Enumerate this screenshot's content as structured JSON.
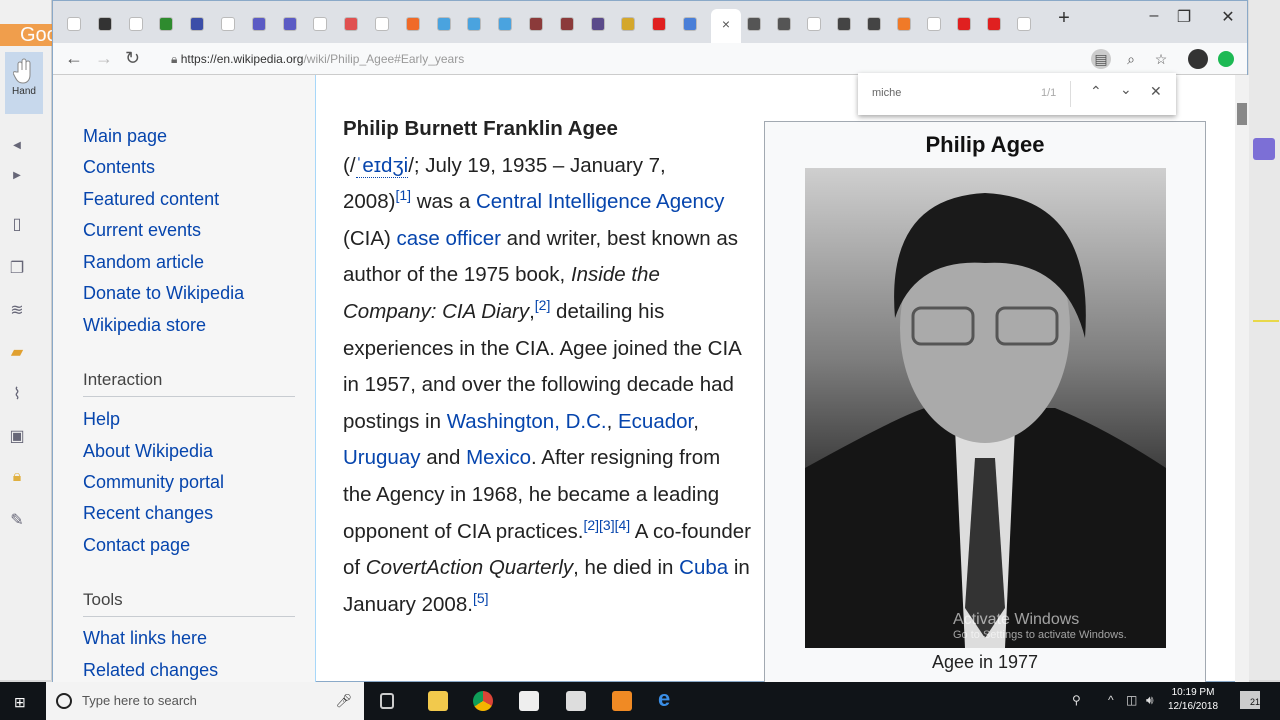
{
  "left_panel": {
    "brand_text": "Google",
    "hand_label": "Hand"
  },
  "browser": {
    "url_host": "https://en.wikipedia.org",
    "url_path": "/wiki/Philip_Agee#Early_years",
    "new_tab": "+",
    "active_tab_close": "×",
    "tab_colors": [
      "#ffffff",
      "#333333",
      "#ffffff",
      "#2e8b2e",
      "#3b4ea8",
      "#ffffff",
      "#5b5bc4",
      "#5b5bc4",
      "#ffffff",
      "#e05050",
      "#ffffff",
      "#f06a28",
      "#4aa3df",
      "#4aa3df",
      "#4aa3df",
      "#8b3a3a",
      "#8b3a3a",
      "#5a4a8a",
      "#d4a72c",
      "#e02020",
      "#4a7fd8"
    ],
    "tab_colors_right": [
      "#555555",
      "#555555",
      "#ffffff",
      "#444444",
      "#444444",
      "#f07a28",
      "#ffffff",
      "#e02020",
      "#e02020",
      "#ffffff"
    ]
  },
  "findbar": {
    "query": "miche",
    "count": "1/1"
  },
  "sidebar": {
    "nav": [
      "Main page",
      "Contents",
      "Featured content",
      "Current events",
      "Random article",
      "Donate to Wikipedia",
      "Wikipedia store"
    ],
    "interaction_heading": "Interaction",
    "interaction": [
      "Help",
      "About Wikipedia",
      "Community portal",
      "Recent changes",
      "Contact page"
    ],
    "tools_heading": "Tools",
    "tools": [
      "What links here",
      "Related changes"
    ]
  },
  "article": {
    "name": "Philip Burnett Franklin Agee",
    "t1": "(/",
    "ipa": "ˈeɪdʒi",
    "t2": "/; July 19, 1935 – January 7,",
    "t3": "2008)",
    "ref1": "[1]",
    "t4": " was a ",
    "l_cia": "Central Intelligence Agency",
    "t5": " (CIA) ",
    "l_case": "case officer",
    "t6": " and writer, best known as author of the 1975 book, ",
    "book": "Inside the Company: CIA Diary",
    "t7": ",",
    "ref2": "[2]",
    "t8": " detailing his experiences in the CIA. Agee joined the CIA in 1957, and over the following decade had postings in ",
    "l_dc": "Washington, D.C.",
    "c1": ", ",
    "l_ecuador": "Ecuador",
    "c2": ",",
    "l_uruguay": "Uruguay",
    "t9": " and ",
    "l_mexico": "Mexico",
    "t10": ". After resigning from the Agency in 1968, he became a leading opponent of CIA practices.",
    "ref3": "[2][3][4]",
    "t11": " A co-founder of ",
    "magazine": "CovertAction Quarterly",
    "t12": ", he died in ",
    "l_cuba": "Cuba",
    "t13": " in January 2008.",
    "ref5": "[5]"
  },
  "infobox": {
    "title": "Philip Agee",
    "caption": "Agee in 1977"
  },
  "watermark": {
    "line1": "Activate Windows",
    "line2": "Go to Settings to activate Windows."
  },
  "taskbar": {
    "search_placeholder": "Type here to search",
    "time": "10:19 PM",
    "date": "12/16/2018",
    "notif_count": "21"
  }
}
